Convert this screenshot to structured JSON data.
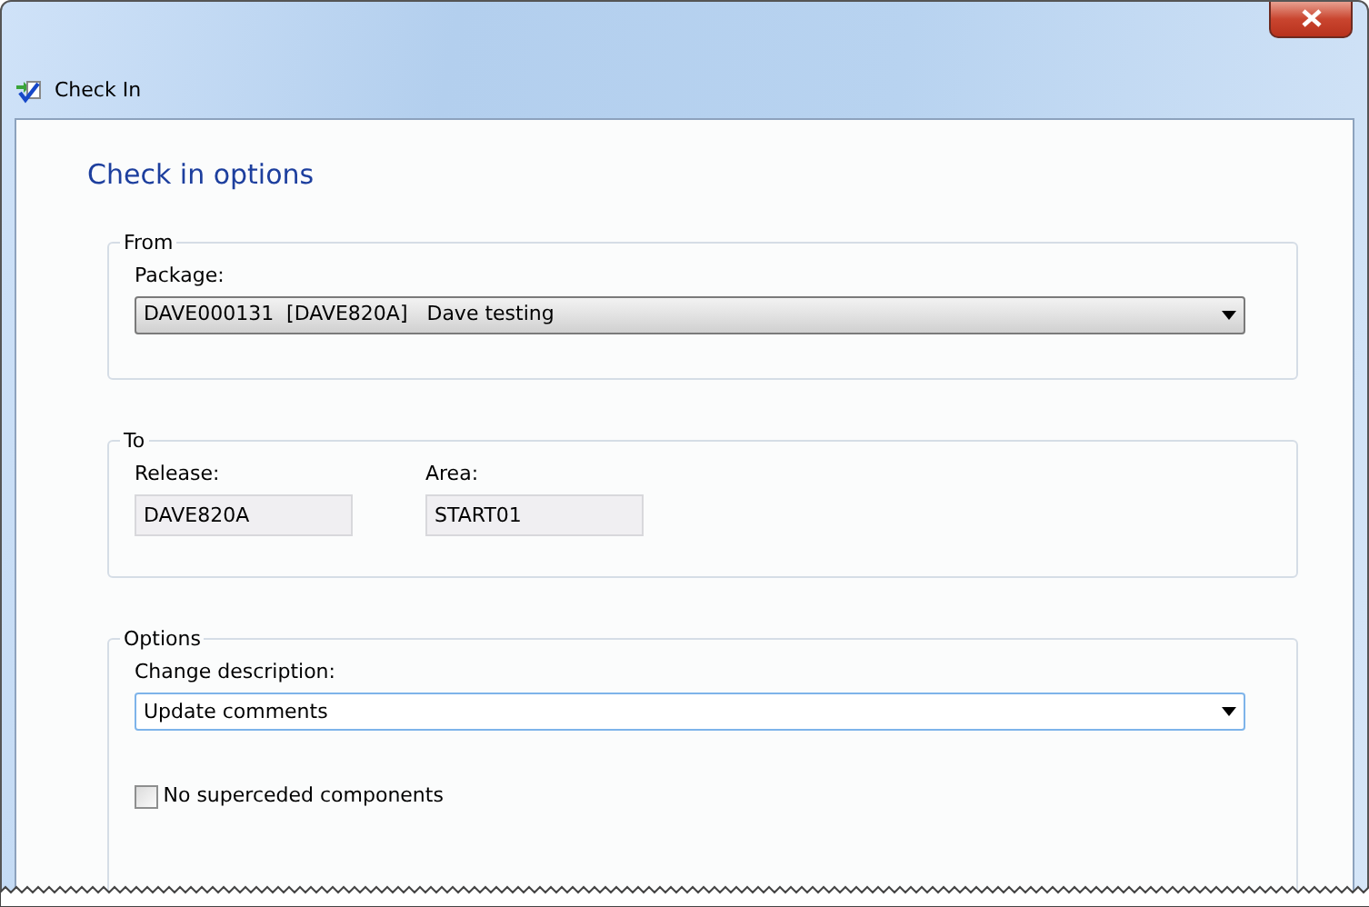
{
  "window": {
    "title": "Check In"
  },
  "heading": "Check in options",
  "groups": [
    {
      "legend": "From",
      "fields": [
        {
          "kind": "dropdown",
          "label": "Package:",
          "value": "DAVE000131  [DAVE820A]   Dave testing",
          "focused": false
        }
      ]
    },
    {
      "legend": "To",
      "fields": [
        {
          "kind": "readonly",
          "label": "Release:",
          "value": "DAVE820A"
        },
        {
          "kind": "readonly",
          "label": "Area:",
          "value": "START01"
        }
      ]
    },
    {
      "legend": "Options",
      "fields": [
        {
          "kind": "dropdown",
          "label": "Change description:",
          "value": "Update comments",
          "focused": true
        },
        {
          "kind": "checkbox",
          "label": "No superceded components",
          "checked": false
        }
      ]
    }
  ]
}
